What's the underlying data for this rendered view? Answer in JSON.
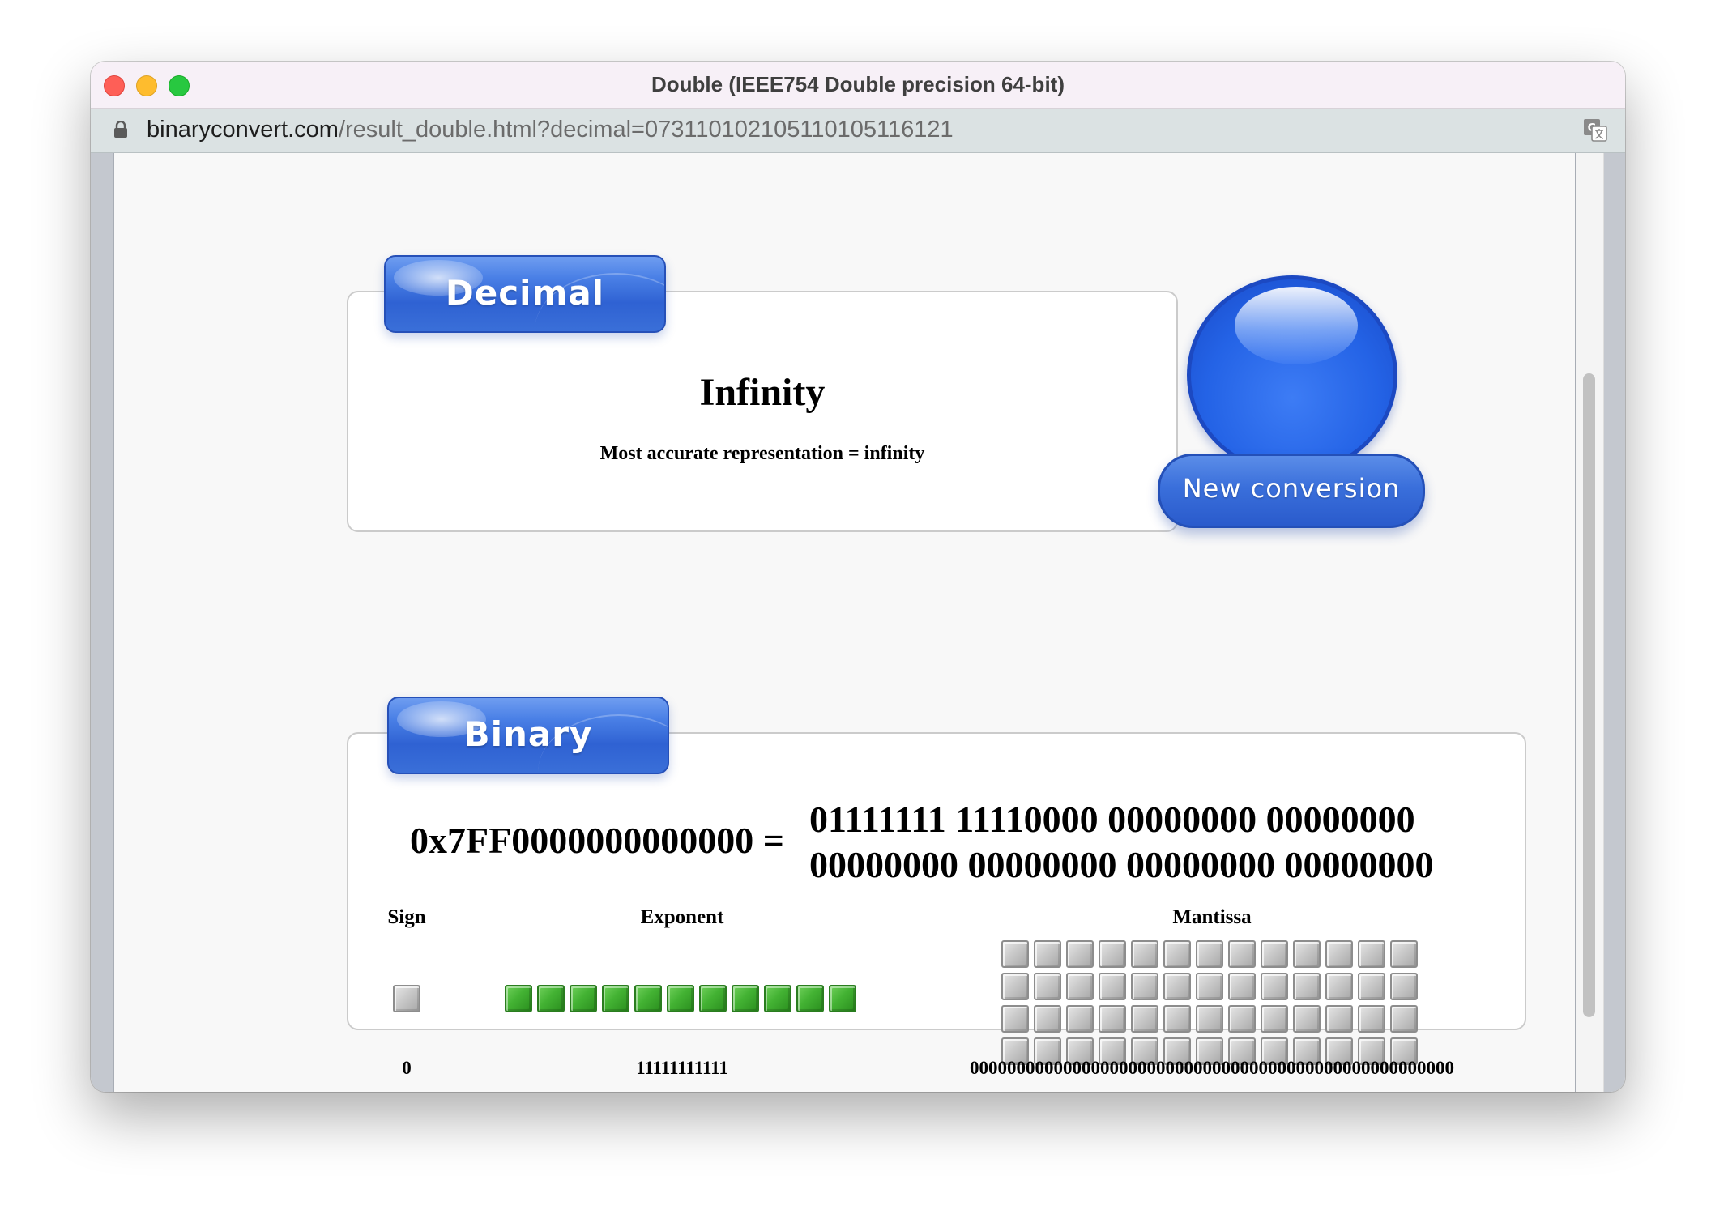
{
  "window": {
    "title": "Double (IEEE754 Double precision 64-bit)"
  },
  "address_bar": {
    "url_host": "binaryconvert.com",
    "url_path": "/result_double.html?decimal=073110102105110105116121"
  },
  "decimal": {
    "tab_label": "Decimal",
    "value": "Infinity",
    "note": "Most accurate representation = infinity"
  },
  "new_conversion": {
    "label": "New conversion"
  },
  "binary": {
    "tab_label": "Binary",
    "hex": "0x7FF0000000000000 =",
    "binary_line1": "01111111 11110000 00000000 00000000",
    "binary_line2": "00000000 00000000 00000000 00000000",
    "sign": {
      "header": "Sign",
      "value": "0",
      "bits": [
        0
      ]
    },
    "exponent": {
      "header": "Exponent",
      "value": "11111111111",
      "bits": [
        1,
        1,
        1,
        1,
        1,
        1,
        1,
        1,
        1,
        1,
        1
      ]
    },
    "mantissa": {
      "header": "Mantissa",
      "value": "0000000000000000000000000000000000000000000000000000",
      "bits": [
        0,
        0,
        0,
        0,
        0,
        0,
        0,
        0,
        0,
        0,
        0,
        0,
        0,
        0,
        0,
        0,
        0,
        0,
        0,
        0,
        0,
        0,
        0,
        0,
        0,
        0,
        0,
        0,
        0,
        0,
        0,
        0,
        0,
        0,
        0,
        0,
        0,
        0,
        0,
        0,
        0,
        0,
        0,
        0,
        0,
        0,
        0,
        0,
        0,
        0,
        0,
        0
      ]
    }
  },
  "colors": {
    "bit_on": "#43b233",
    "bit_off": "#c9c9c9",
    "accent_blue": "#2f62d3"
  },
  "icons": {
    "lock": "lock-icon",
    "translate": "translate-icon"
  }
}
